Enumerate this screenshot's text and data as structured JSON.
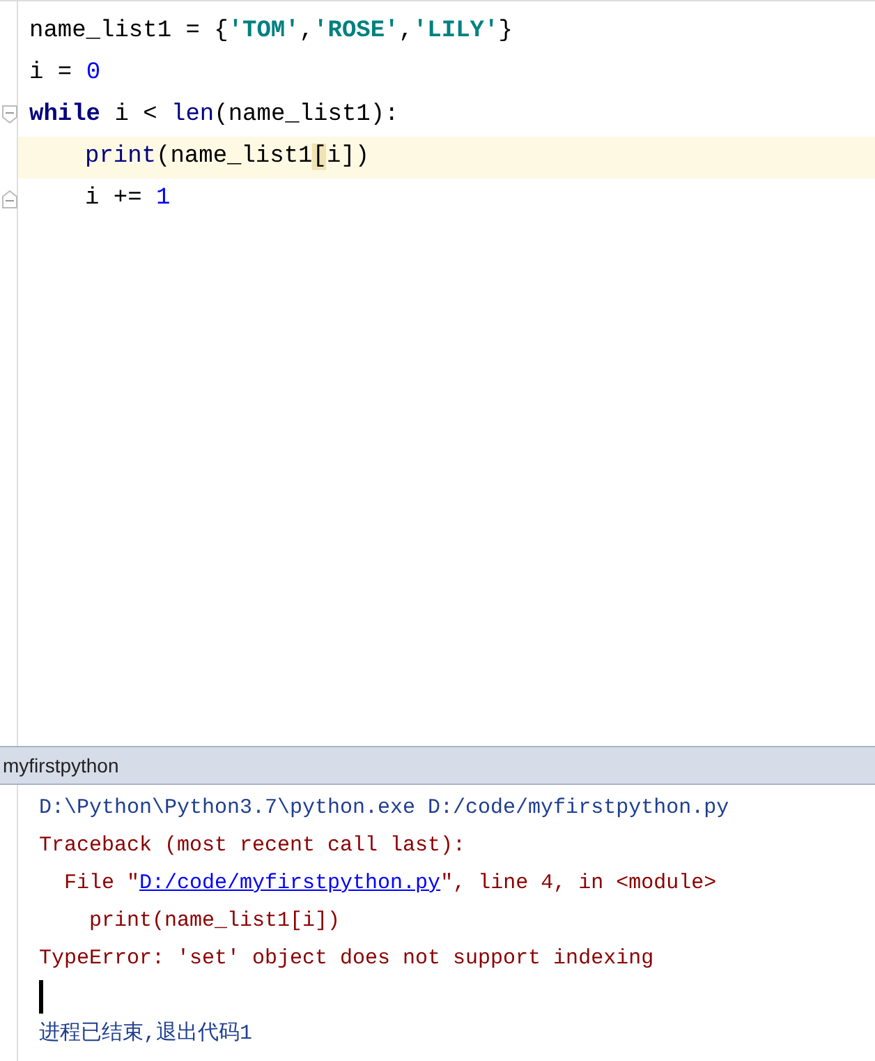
{
  "editor": {
    "lines": [
      {
        "highlighted": false,
        "kind": "plain",
        "tokens": [
          {
            "kind": "plain",
            "text": "name_list1 = "
          },
          {
            "kind": "brace",
            "text": "{"
          },
          {
            "kind": "string",
            "text": "'TOM'"
          },
          {
            "kind": "plain",
            "text": ","
          },
          {
            "kind": "string",
            "text": "'ROSE'"
          },
          {
            "kind": "plain",
            "text": ","
          },
          {
            "kind": "string",
            "text": "'LILY'"
          },
          {
            "kind": "brace",
            "text": "}"
          }
        ]
      },
      {
        "highlighted": false,
        "kind": "plain",
        "tokens": [
          {
            "kind": "plain",
            "text": "i = "
          },
          {
            "kind": "number",
            "text": "0"
          }
        ]
      },
      {
        "highlighted": false,
        "kind": "foldstart",
        "tokens": [
          {
            "kind": "keyword",
            "text": "while"
          },
          {
            "kind": "plain",
            "text": " i < "
          },
          {
            "kind": "builtin",
            "text": "len"
          },
          {
            "kind": "plain",
            "text": "(name_list1):"
          }
        ],
        "children": [
          {
            "highlighted": true,
            "kind": "plain",
            "tokens": [
              {
                "kind": "builtin",
                "text": "print"
              },
              {
                "kind": "plain",
                "text": "(name_list1"
              },
              {
                "kind": "match",
                "text": "["
              },
              {
                "kind": "plain",
                "text": "i])"
              }
            ]
          },
          {
            "highlighted": false,
            "kind": "foldend",
            "tokens": [
              {
                "kind": "plain",
                "text": "i += "
              },
              {
                "kind": "number",
                "text": "1"
              }
            ]
          }
        ]
      }
    ]
  },
  "console": {
    "title": "myfirstpython",
    "lines": [
      {
        "segments": [
          {
            "kind": "system",
            "text": "D:\\Python\\Python3.7\\python.exe D:/code/myfirstpython.py"
          }
        ]
      },
      {
        "segments": [
          {
            "kind": "error",
            "text": "Traceback (most recent call last):"
          }
        ]
      },
      {
        "segments": [
          {
            "kind": "error",
            "text": "  File \""
          },
          {
            "kind": "link",
            "text": "D:/code/myfirstpython.py"
          },
          {
            "kind": "error",
            "text": "\", line 4, in <module>"
          }
        ]
      },
      {
        "segments": [
          {
            "kind": "error",
            "text": "    print(name_list1[i])"
          }
        ]
      },
      {
        "segments": [
          {
            "kind": "error",
            "text": "TypeError: 'set' object does not support indexing"
          }
        ]
      },
      {
        "segments": [
          {
            "kind": "caret"
          }
        ]
      },
      {
        "segments": [
          {
            "kind": "system",
            "text": "进程已结束,退出代码1"
          }
        ]
      }
    ]
  }
}
